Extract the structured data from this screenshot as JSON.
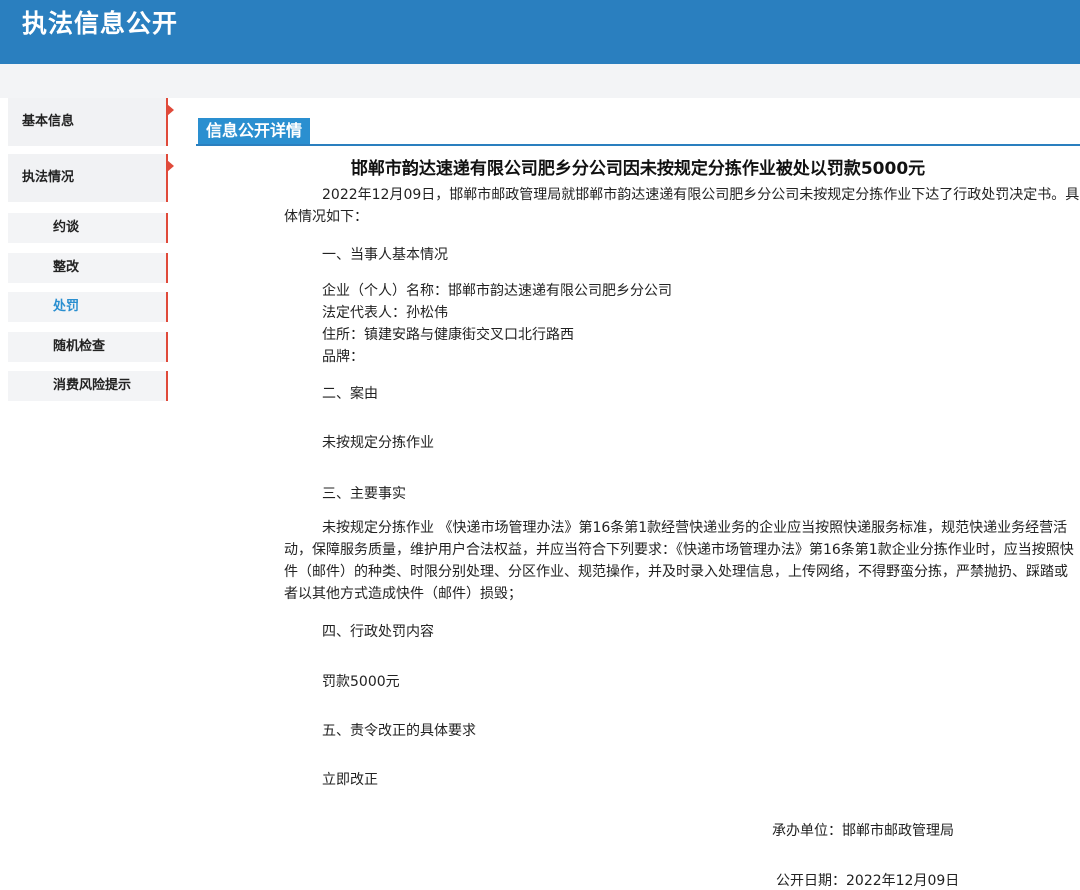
{
  "header": {
    "title": "执法信息公开"
  },
  "sidebar": {
    "main_items": [
      {
        "label": "基本信息"
      },
      {
        "label": "执法情况"
      }
    ],
    "sub_items": [
      {
        "label": "约谈",
        "active": false
      },
      {
        "label": "整改",
        "active": false
      },
      {
        "label": "处罚",
        "active": true
      },
      {
        "label": "随机检查",
        "active": false
      },
      {
        "label": "消费风险提示",
        "active": false
      }
    ]
  },
  "section": {
    "tab_label": "信息公开详情"
  },
  "article": {
    "title": "邯郸市韵达速递有限公司肥乡分公司因未按规定分拣作业被处以罚款5000元",
    "intro": "2022年12月09日，邯郸市邮政管理局就邯郸市韵达速递有限公司肥乡分公司未按规定分拣作业下达了行政处罚决定书。具体情况如下：",
    "h1": "一、当事人基本情况",
    "party_name": "企业（个人）名称：邯郸市韵达速递有限公司肥乡分公司",
    "legal_rep": "法定代表人：孙松伟",
    "address": "住所：镇建安路与健康街交叉口北行路西",
    "brand": "品牌：",
    "h2": "二、案由",
    "cause": "未按规定分拣作业",
    "h3": "三、主要事实",
    "facts": "未按规定分拣作业 《快递市场管理办法》第16条第1款经营快递业务的企业应当按照快递服务标准，规范快递业务经营活动，保障服务质量，维护用户合法权益，并应当符合下列要求：《快递市场管理办法》第16条第1款企业分拣作业时，应当按照快件（邮件）的种类、时限分别处理、分区作业、规范操作，并及时录入处理信息，上传网络，不得野蛮分拣，严禁抛扔、踩踏或者以其他方式造成快件（邮件）损毁；",
    "h4": "四、行政处罚内容",
    "penalty": "罚款5000元",
    "h5": "五、责令改正的具体要求",
    "correction": "立即改正",
    "unit": "承办单位：邯郸市邮政管理局",
    "date": "公开日期：2022年12月09日"
  }
}
